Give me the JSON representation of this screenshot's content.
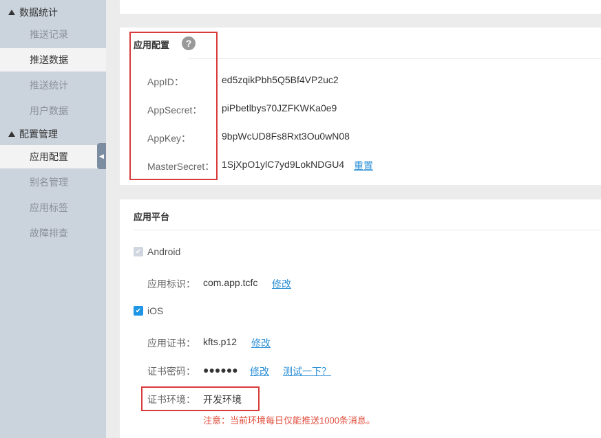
{
  "sidebar": {
    "groups": [
      {
        "label": "数据统计"
      },
      {
        "label": "配置管理"
      }
    ],
    "items": [
      {
        "label": "推送记录"
      },
      {
        "label": "推送数据"
      },
      {
        "label": "推送统计"
      },
      {
        "label": "用户数据"
      },
      {
        "label": "应用配置"
      },
      {
        "label": "别名管理"
      },
      {
        "label": "应用标签"
      },
      {
        "label": "故障排查"
      }
    ],
    "active_item": "应用配置",
    "collapse_glyph": "◀"
  },
  "config": {
    "title": "应用配置",
    "help_glyph": "?",
    "rows": [
      {
        "label": "AppID：",
        "value": "ed5zqikPbh5Q5Bf4VP2uc2"
      },
      {
        "label": "AppSecret：",
        "value": "piPbetlbys70JZFKWKa0e9"
      },
      {
        "label": "AppKey：",
        "value": "9bpWcUD8Fs8Rxt3Ou0wN08"
      },
      {
        "label": "MasterSecret：",
        "value": "1SjXpO1ylC7yd9LokNDGU4"
      }
    ],
    "reset_link": "重置"
  },
  "platform": {
    "title": "应用平台",
    "android": {
      "label": "Android",
      "checked": true,
      "disabled": true,
      "id_label": "应用标识：",
      "id_value": "com.app.tcfc",
      "edit_link": "修改"
    },
    "ios": {
      "label": "iOS",
      "checked": true,
      "cert_label": "应用证书：",
      "cert_value": "kfts.p12",
      "cert_edit": "修改",
      "pwd_label": "证书密码：",
      "pwd_value": "●●●●●●",
      "pwd_edit": "修改",
      "test_link": "测试一下？",
      "env_label": "证书环境：",
      "env_value": "开发环境",
      "warning": "注意：当前环境每日仅能推送1000条消息。"
    }
  },
  "colors": {
    "accent": "#2a8fd6",
    "highlight_box": "#d93a3a",
    "warning": "#e0503f"
  }
}
